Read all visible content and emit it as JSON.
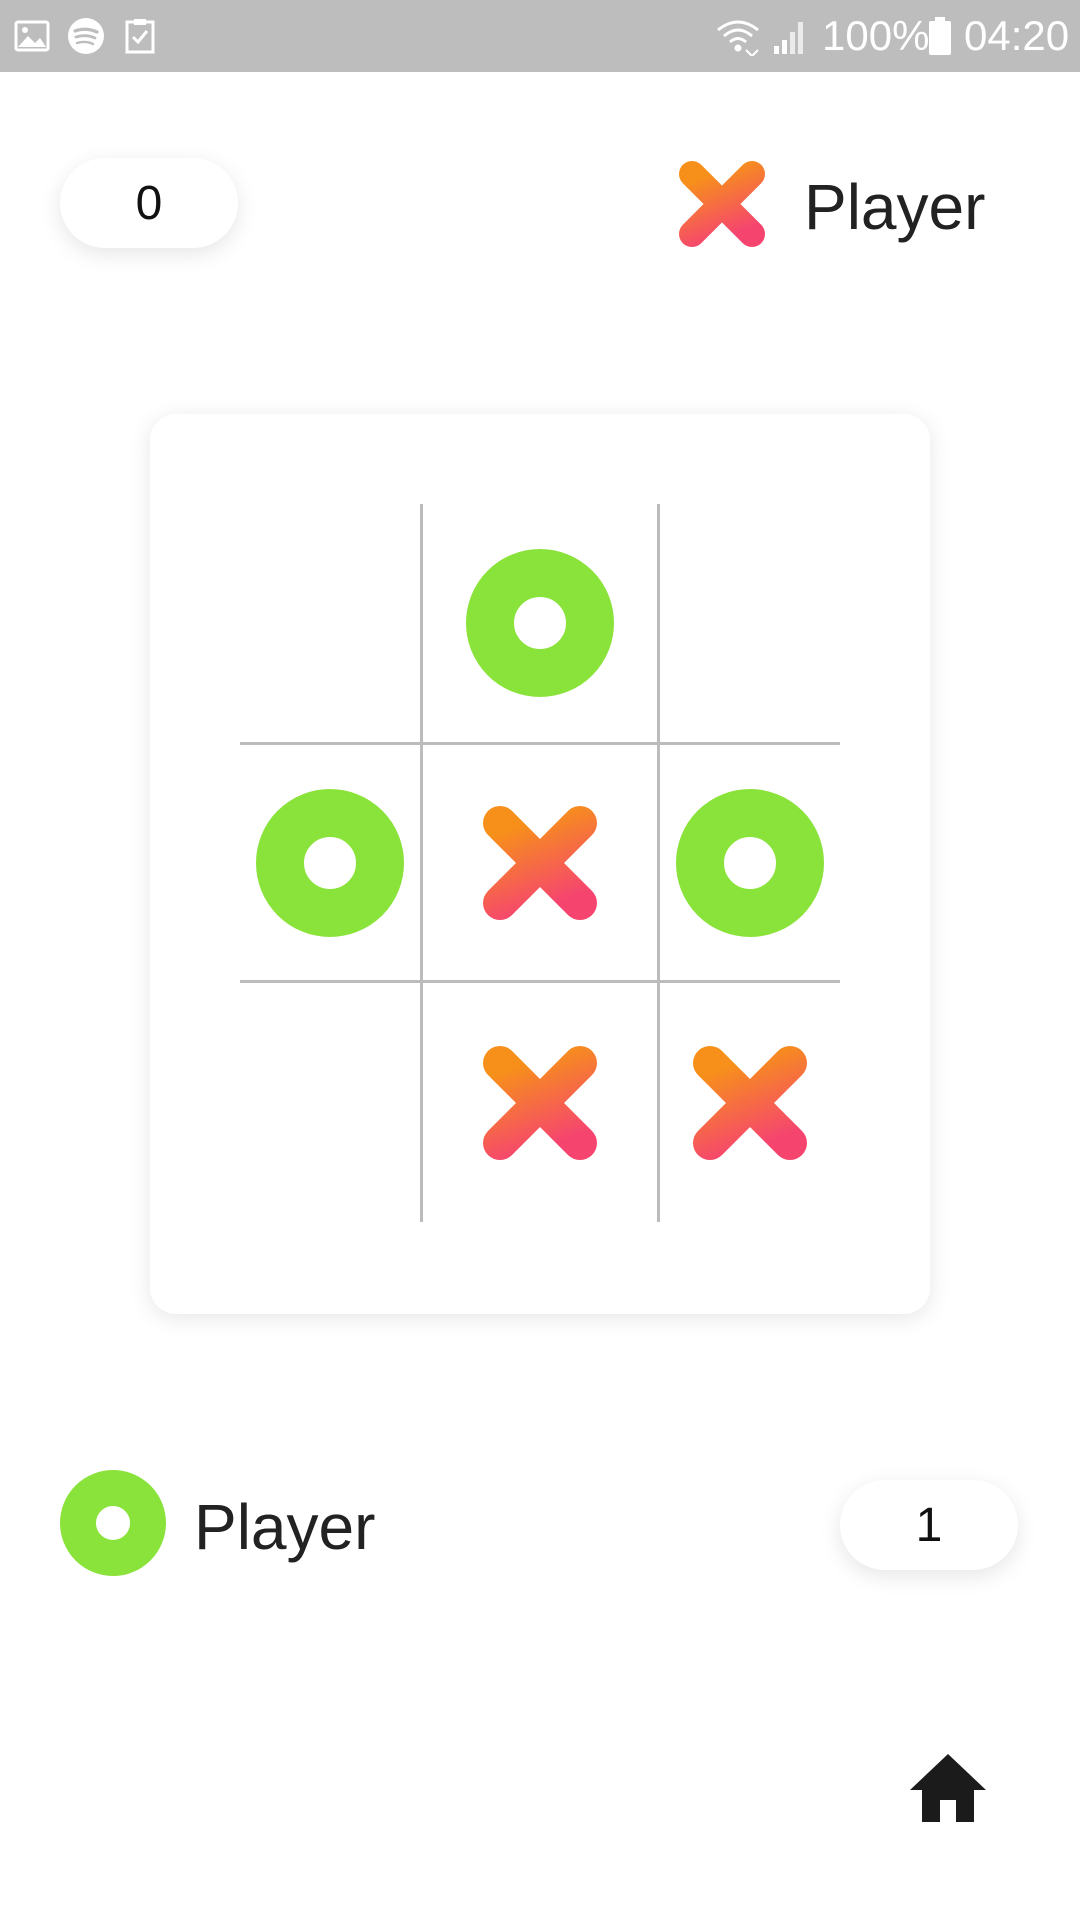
{
  "status_bar": {
    "battery": "100%",
    "time": "04:20",
    "notification_icons": [
      "gallery-icon",
      "spotify-icon",
      "task-icon"
    ],
    "system_icons": [
      "wifi-icon",
      "signal-icon",
      "battery-icon"
    ]
  },
  "players": {
    "x": {
      "label": "Player",
      "score": "0",
      "symbol": "x-mark-icon"
    },
    "o": {
      "label": "Player",
      "score": "1",
      "symbol": "o-mark-icon"
    }
  },
  "board": {
    "cells": [
      "",
      "O",
      "",
      "O",
      "X",
      "O",
      "",
      "X",
      "X"
    ]
  },
  "colors": {
    "o_mark": "#8AE33A",
    "x_gradient_start": "#F7901A",
    "x_gradient_end": "#F5456F",
    "grid_line": "#BCBCBC",
    "status_bar": "#BDBDBD"
  },
  "home_icon": "home-icon"
}
